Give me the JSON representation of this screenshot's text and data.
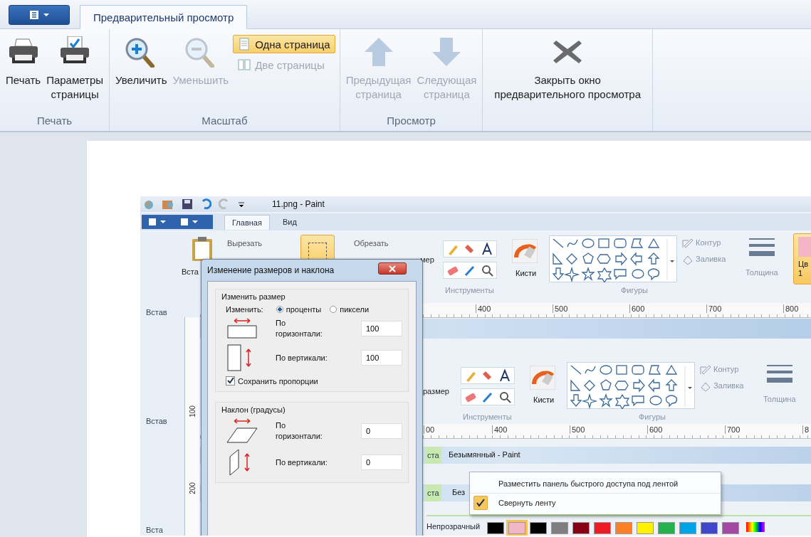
{
  "ribbon": {
    "tabs": [
      {
        "label": "Предварительный просмотр",
        "selected": true
      }
    ],
    "groups": [
      {
        "label": "Печать",
        "items": [
          {
            "kind": "large",
            "label": "Печать",
            "disabled": false
          },
          {
            "kind": "large",
            "label": "Параметры\nстраницы",
            "disabled": false
          }
        ]
      },
      {
        "label": "Масштаб",
        "items": [
          {
            "kind": "large",
            "label": "Увеличить",
            "disabled": false
          },
          {
            "kind": "large",
            "label": "Уменьшить",
            "disabled": true
          },
          {
            "kind": "stack",
            "children": [
              {
                "label": "Одна страница",
                "selected": true,
                "disabled": false
              },
              {
                "label": "Две страницы",
                "selected": false,
                "disabled": true
              }
            ]
          }
        ]
      },
      {
        "label": "Просмотр",
        "items": [
          {
            "kind": "large",
            "label": "Предыдущая\nстраница",
            "disabled": true
          },
          {
            "kind": "large",
            "label": "Следующая\nстраница",
            "disabled": true
          }
        ]
      },
      {
        "items": [
          {
            "kind": "large",
            "label": "Закрыть окно\nпредварительного просмотра",
            "disabled": false
          }
        ]
      }
    ]
  },
  "preview": {
    "title": "11.png - Paint",
    "tabs": [
      {
        "label": "Главная",
        "selected": true
      },
      {
        "label": "Вид",
        "selected": false
      }
    ],
    "clipboard": {
      "paste": "Вста",
      "cut": "Вырезать",
      "crop": "Обрезать",
      "resize_tail": "мер"
    },
    "side_labels": [
      "Встав",
      "Встав",
      "Вста"
    ],
    "side_ruler": [
      "100",
      "200"
    ],
    "ribbons": [
      {
        "tools": "Инструменты",
        "brushes": "Кисти",
        "shapes": "Фигуры",
        "outline": "Контур",
        "fill": "Заливка",
        "size": "Толщина",
        "colors": "Цв",
        "colors_number": "1"
      },
      {
        "tools": "Инструменты",
        "brushes": "Кисти",
        "shapes": "Фигуры",
        "outline": "Контур",
        "fill": "Заливка",
        "size": "Толщина",
        "left_text": "размер"
      }
    ],
    "rulers": [
      [
        "400",
        "500",
        "600",
        "700",
        "800"
      ],
      [
        "00",
        "400",
        "500",
        "600",
        "700",
        "8"
      ]
    ],
    "window_bars": [
      {
        "tab": "ста",
        "title": "Безымянный - Paint"
      },
      {
        "tab": "ста",
        "title": "Без"
      }
    ],
    "context_menu": [
      {
        "label": "Разместить панель быстрого доступа под лентой",
        "checked": false
      },
      {
        "label": "Свернуть ленту",
        "checked": true
      }
    ],
    "bottom": {
      "label": "Непрозрачный",
      "swatches": [
        {
          "color": "#000000",
          "selected": false
        },
        {
          "color": "#f4b6c6",
          "selected": true
        },
        {
          "color": "#000000",
          "selected": false
        },
        {
          "color": "#7f7f7f",
          "selected": false
        },
        {
          "color": "#880015",
          "selected": false
        },
        {
          "color": "#ed1c24",
          "selected": false
        },
        {
          "color": "#ff7f27",
          "selected": false
        },
        {
          "color": "#fff200",
          "selected": false
        },
        {
          "color": "#22b14c",
          "selected": false
        },
        {
          "color": "#00a2e8",
          "selected": false
        },
        {
          "color": "#3f48cc",
          "selected": false
        },
        {
          "color": "#a349a4",
          "selected": false
        }
      ]
    },
    "dialog": {
      "title": "Изменение размеров и наклона",
      "resize": {
        "title": "Изменить размер",
        "by_label": "Изменить:",
        "options": [
          {
            "label": "проценты",
            "selected": true
          },
          {
            "label": "пиксели",
            "selected": false
          }
        ],
        "fields": [
          {
            "label": "По\nгоризонтали:",
            "value": "100"
          },
          {
            "label": "По вертикали:",
            "value": "100"
          }
        ],
        "keep_ratio": {
          "label": "Сохранить пропорции",
          "checked": true
        }
      },
      "skew": {
        "title": "Наклон (градусы)",
        "fields": [
          {
            "label": "По\nгоризонтали:",
            "value": "0"
          },
          {
            "label": "По вертикали:",
            "value": "0"
          }
        ]
      }
    }
  }
}
